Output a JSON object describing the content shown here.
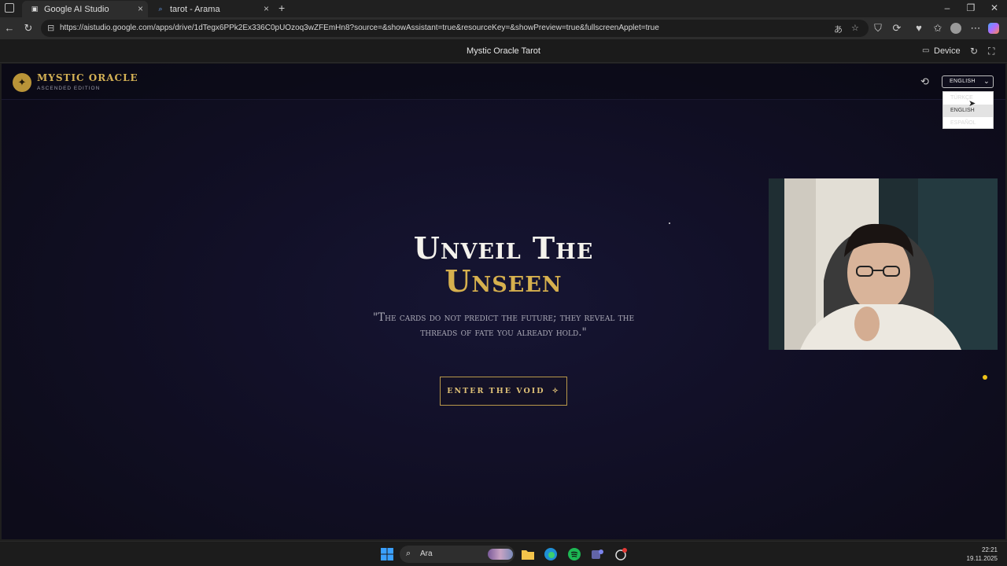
{
  "browser": {
    "tabs": [
      {
        "title": "Google AI Studio",
        "active": true
      },
      {
        "title": "tarot - Arama",
        "active": false
      }
    ],
    "url": "https://aistudio.google.com/apps/drive/1dTegx6PPk2Ex336C0pUOzoq3wZFEmHn8?source=&showAssistant=true&resourceKey=&showPreview=true&fullscreenApplet=true"
  },
  "studio_header": {
    "title": "Mystic Oracle Tarot",
    "device_label": "Device"
  },
  "app": {
    "brand": "MYSTIC ORACLE",
    "edition": "ASCENDED EDITION",
    "language": {
      "selected": "ENGLISH",
      "options": [
        "TÜRKÇE",
        "ENGLISH",
        "ESPAÑOL"
      ]
    },
    "hero": {
      "line1": "Unveil The",
      "line2": "Unseen",
      "quote": "\"The cards do not predict the future; they reveal the threads of fate you already hold.\""
    },
    "cta_label": "ENTER THE VOID"
  },
  "taskbar": {
    "search_placeholder": "Ara",
    "time": "22:21",
    "date": "19.11.2025"
  },
  "colors": {
    "gold": "#d6b04e",
    "background": "#110f25"
  }
}
